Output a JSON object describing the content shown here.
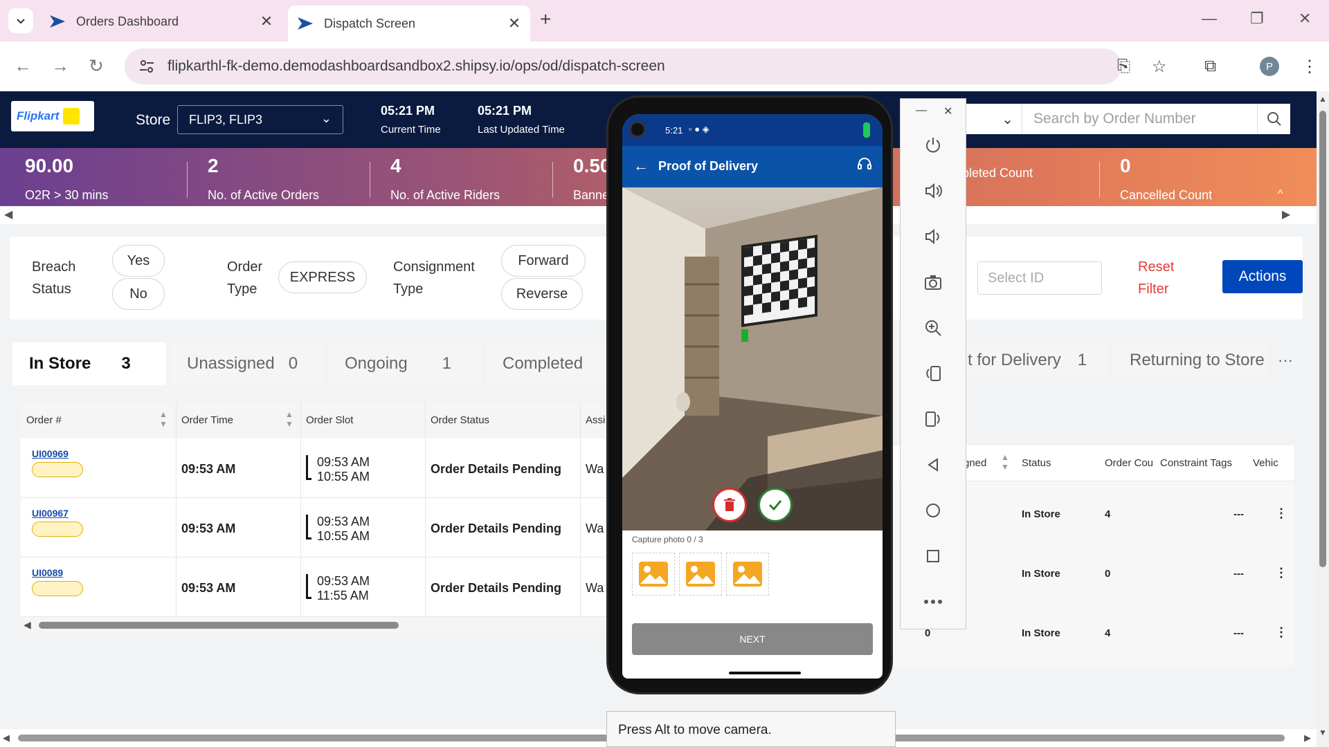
{
  "browser": {
    "tabs": [
      {
        "title": "Orders Dashboard",
        "active": false
      },
      {
        "title": "Dispatch Screen",
        "active": true
      }
    ],
    "url": "flipkarthl-fk-demo.demodashboardsandbox2.shipsy.io/ops/od/dispatch-screen",
    "profile_initial": "P"
  },
  "header": {
    "logo_text": "Flipkart",
    "store_label": "Store",
    "store_value": "FLIP3, FLIP3",
    "current_time": "05:21 PM",
    "current_time_label": "Current Time",
    "last_updated": "05:21 PM",
    "last_updated_label": "Last Updated Time",
    "search_placeholder": "Search by Order Number"
  },
  "metrics": [
    {
      "value": "90.00",
      "label": "O2R > 30 mins"
    },
    {
      "value": "2",
      "label": "No. of Active Orders"
    },
    {
      "value": "4",
      "label": "No. of Active Riders"
    },
    {
      "value": "0.50",
      "label": "Banne"
    },
    {
      "value": "",
      "label": "pleted Count"
    },
    {
      "value": "0",
      "label": "Cancelled Count"
    }
  ],
  "filters": {
    "breach_label_1": "Breach",
    "breach_label_2": "Status",
    "yes": "Yes",
    "no": "No",
    "order_label_1": "Order",
    "order_label_2": "Type",
    "express": "EXPRESS",
    "consignment_label_1": "Consignment",
    "consignment_label_2": "Type",
    "forward": "Forward",
    "reverse": "Reverse",
    "select_id_placeholder": "Select ID",
    "reset_1": "Reset",
    "reset_2": "Filter",
    "actions": "Actions"
  },
  "status_tabs": [
    {
      "label": "In Store",
      "count": "3"
    },
    {
      "label": "Unassigned",
      "count": "0"
    },
    {
      "label": "Ongoing",
      "count": "1"
    },
    {
      "label": "Completed",
      "count": ""
    },
    {
      "label": "t for Delivery",
      "count": "1"
    },
    {
      "label": "Returning to Store",
      "count": ""
    }
  ],
  "orders_table": {
    "columns": [
      "Order #",
      "Order Time",
      "Order Slot",
      "Order Status",
      "Assi"
    ],
    "rows": [
      {
        "id": "UI00969",
        "time": "09:53 AM",
        "slot_start": "09:53 AM",
        "slot_end": "10:55 AM",
        "status": "Order Details Pending",
        "assigned": "Wa"
      },
      {
        "id": "UI00967",
        "time": "09:53 AM",
        "slot_start": "09:53 AM",
        "slot_end": "10:55 AM",
        "status": "Order Details Pending",
        "assigned": "Wa"
      },
      {
        "id": "UI0089",
        "time": "09:53 AM",
        "slot_start": "09:53 AM",
        "slot_end": "11:55 AM",
        "status": "Order Details Pending",
        "assigned": "Wa"
      }
    ]
  },
  "riders_table": {
    "columns": [
      "gned",
      "Status",
      "Order Cou",
      "Constraint Tags",
      "Vehic"
    ],
    "rows": [
      {
        "assigned": "",
        "status": "In Store",
        "count": "4",
        "tags": "---"
      },
      {
        "assigned": "",
        "status": "In Store",
        "count": "0",
        "tags": "---"
      },
      {
        "assigned": "0",
        "status": "In Store",
        "count": "4",
        "tags": "---"
      }
    ]
  },
  "phone": {
    "status_time": "5:21",
    "title": "Proof of Delivery",
    "capture_text": "Capture photo 0 / 3",
    "next": "NEXT"
  },
  "tooltip": "Press Alt to move camera.",
  "colors": {
    "app_header": "#0b1b3f",
    "phone_appbar": "#0b53a8",
    "actions_button": "#0047bb",
    "reset_text": "#e53935"
  }
}
